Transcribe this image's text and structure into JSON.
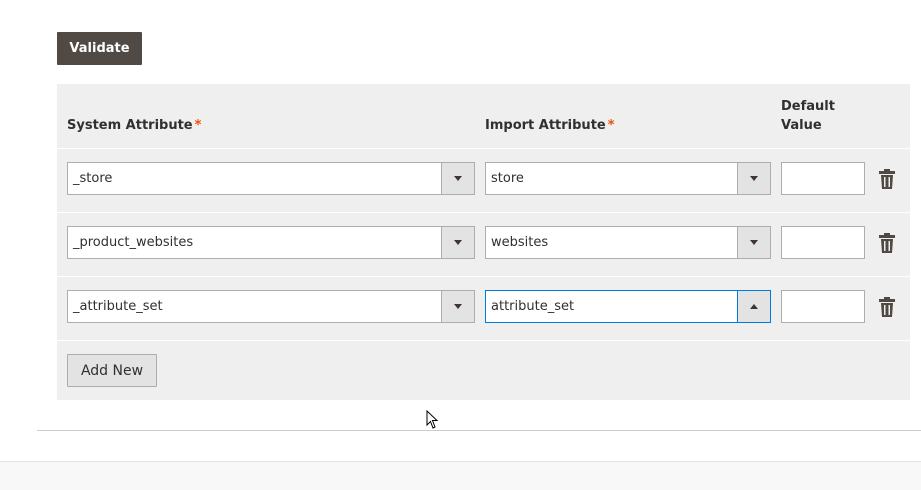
{
  "actions": {
    "validate_label": "Validate",
    "add_new_label": "Add New"
  },
  "table": {
    "headers": {
      "system_attribute": "System Attribute",
      "import_attribute": "Import Attribute",
      "default_value": "Default Value",
      "required_marker": "*"
    },
    "rows": [
      {
        "system_attribute": "_store",
        "import_attribute": "store",
        "default_value": "",
        "import_dropdown_open": false
      },
      {
        "system_attribute": "_product_websites",
        "import_attribute": "websites",
        "default_value": "",
        "import_dropdown_open": false
      },
      {
        "system_attribute": "_attribute_set",
        "import_attribute": "attribute_set",
        "default_value": "",
        "import_dropdown_open": true
      }
    ]
  },
  "icons": {
    "row_delete": "trash-icon",
    "select_toggle": "chevron-down-icon",
    "select_toggle_open": "chevron-up-icon",
    "mouse_pointer": "cursor-arrow-icon"
  },
  "colors": {
    "primary_button": "#514943",
    "required": "#eb5202",
    "focus_border": "#007bdb",
    "panel_bg": "#efefef"
  }
}
